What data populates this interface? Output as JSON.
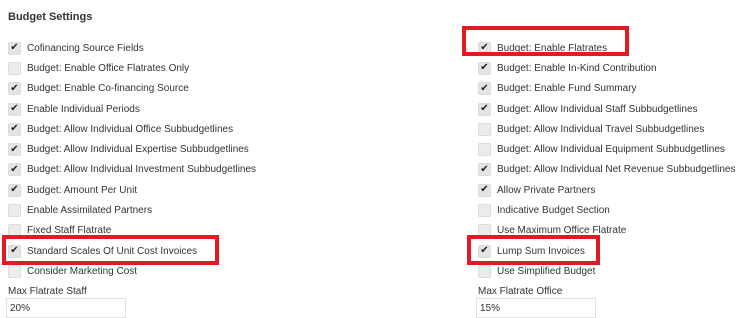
{
  "title": "Budget Settings",
  "left_items": [
    {
      "label": "Cofinancing Source Fields",
      "checked": true
    },
    {
      "label": "Budget: Enable Office Flatrates Only",
      "checked": false
    },
    {
      "label": "Budget: Enable Co-financing Source",
      "checked": true
    },
    {
      "label": "Enable Individual Periods",
      "checked": true
    },
    {
      "label": "Budget: Allow Individual Office Subbudgetlines",
      "checked": true
    },
    {
      "label": "Budget: Allow Individual Expertise Subbudgetlines",
      "checked": true
    },
    {
      "label": "Budget: Allow Individual Investment Subbudgetlines",
      "checked": true
    },
    {
      "label": "Budget: Amount Per Unit",
      "checked": true
    },
    {
      "label": "Enable Assimilated Partners",
      "checked": false
    },
    {
      "label": "Fixed Staff Flatrate",
      "checked": false
    },
    {
      "label": "Standard Scales Of Unit Cost Invoices",
      "checked": true
    },
    {
      "label": "Consider Marketing Cost",
      "checked": false
    }
  ],
  "right_items": [
    {
      "label": "Budget: Enable Flatrates",
      "checked": true
    },
    {
      "label": "Budget: Enable In-Kind Contribution",
      "checked": true
    },
    {
      "label": "Budget: Enable Fund Summary",
      "checked": true
    },
    {
      "label": "Budget: Allow Individual Staff Subbudgetlines",
      "checked": true
    },
    {
      "label": "Budget: Allow Individual Travel Subbudgetlines",
      "checked": false
    },
    {
      "label": "Budget: Allow Individual Equipment Subbudgetlines",
      "checked": false
    },
    {
      "label": "Budget: Allow Individual Net Revenue Subbudgetlines",
      "checked": true
    },
    {
      "label": "Allow Private Partners",
      "checked": true
    },
    {
      "label": "Indicative Budget Section",
      "checked": false
    },
    {
      "label": "Use Maximum Office Flatrate",
      "checked": false
    },
    {
      "label": "Lump Sum Invoices",
      "checked": true
    },
    {
      "label": "Use Simplified Budget",
      "checked": false
    }
  ],
  "check_glyph": "✔",
  "highlight_color": "#e01b22",
  "max_flatrate_staff": {
    "label": "Max Flatrate Staff",
    "value": "20%"
  },
  "max_flatrate_office": {
    "label": "Max Flatrate Office",
    "value": "15%"
  }
}
